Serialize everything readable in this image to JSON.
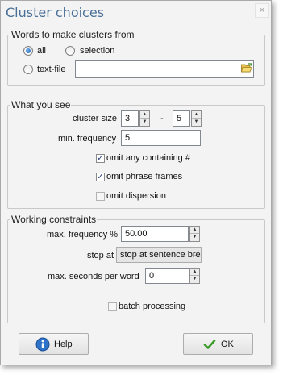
{
  "window": {
    "title": "Cluster choices",
    "close_icon": "×"
  },
  "words_group": {
    "title": "Words to make clusters from",
    "radio_all": "all",
    "radio_selection": "selection",
    "radio_textfile": "text-file",
    "selected": "all",
    "textfile_value": ""
  },
  "see_group": {
    "title": "What you see",
    "cluster_size_label": "cluster size",
    "cluster_min": "3",
    "dash": "-",
    "cluster_max": "5",
    "min_freq_label": "min. frequency",
    "min_freq_value": "5",
    "omit_hash_label": "omit any containing #",
    "omit_hash_checked": true,
    "omit_frames_label": "omit phrase frames",
    "omit_frames_checked": true,
    "omit_dispersion_label": "omit dispersion",
    "omit_dispersion_checked": false
  },
  "constraints_group": {
    "title": "Working constraints",
    "max_freq_label": "max. frequency %",
    "max_freq_value": "50.00",
    "stop_at_label": "stop at",
    "stop_at_value": "stop at sentence break",
    "max_seconds_label": "max. seconds per word",
    "max_seconds_value": "0",
    "batch_label": "batch processing",
    "batch_checked": false
  },
  "buttons": {
    "help": "Help",
    "ok": "OK"
  },
  "icons": {
    "help": "info-icon",
    "ok": "checkmark-icon",
    "folder": "folder-open-icon",
    "close": "close-icon"
  }
}
